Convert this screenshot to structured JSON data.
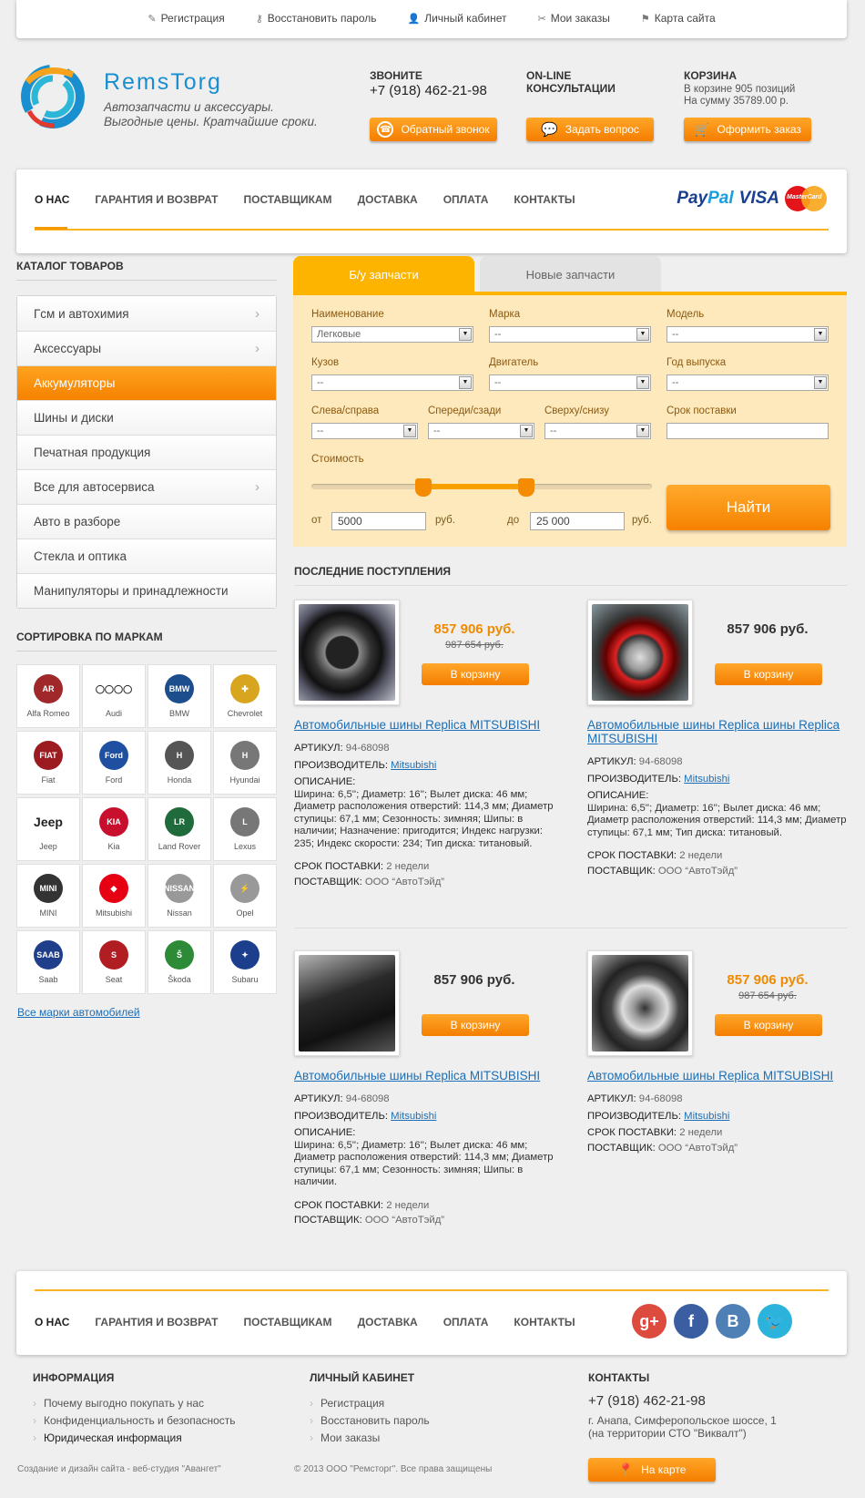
{
  "topbar": {
    "items": [
      {
        "icon": "pencil-icon",
        "glyph": "✎",
        "label": "Регистрация"
      },
      {
        "icon": "key-icon",
        "glyph": "⚷",
        "label": "Восстановить пароль"
      },
      {
        "icon": "user-icon",
        "glyph": "👤",
        "label": "Личный кабинет"
      },
      {
        "icon": "tag-icon",
        "glyph": "✂",
        "label": "Мои заказы"
      },
      {
        "icon": "flag-icon",
        "glyph": "⚑",
        "label": "Карта сайта"
      }
    ]
  },
  "header": {
    "brand": "RemsTorg",
    "slogan1": "Автозапчасти и аксессуары.",
    "slogan2": "Выгодные цены. Кратчайшие сроки.",
    "call_title": "ЗВОНИТЕ",
    "phone": "+7 (918) 462-21-98",
    "callback_btn": "Обратный звонок",
    "online_title1": "ON-LINE",
    "online_title2": "КОНСУЛЬТАЦИИ",
    "ask_btn": "Задать вопрос",
    "cart_title": "КОРЗИНА",
    "cart_line1": "В корзине 905 позиций",
    "cart_line2": "На сумму 35789.00 р.",
    "order_btn": "Оформить заказ"
  },
  "nav": {
    "items": [
      "О НАС",
      "ГАРАНТИЯ И ВОЗВРАТ",
      "ПОСТАВЩИКАМ",
      "ДОСТАВКА",
      "ОПЛАТА",
      "КОНТАКТЫ"
    ],
    "paypal1": "Pay",
    "paypal2": "Pal",
    "visa": "VISA",
    "mastercard": "MasterCard"
  },
  "sidebar": {
    "catalog_title": "КАТАЛОГ ТОВАРОВ",
    "categories": [
      {
        "label": "Гсм и автохимия",
        "arrow": true
      },
      {
        "label": "Аксессуары",
        "arrow": true
      },
      {
        "label": "Аккумуляторы",
        "arrow": false,
        "active": true
      },
      {
        "label": "Шины и диски",
        "arrow": false
      },
      {
        "label": "Печатная продукция",
        "arrow": false
      },
      {
        "label": "Все для автосервиса",
        "arrow": true
      },
      {
        "label": "Авто в разборе",
        "arrow": false
      },
      {
        "label": "Стекла и оптика",
        "arrow": false
      },
      {
        "label": "Манипуляторы и принадлежности",
        "arrow": false
      }
    ],
    "brands_title": "СОРТИРОВКА ПО МАРКАМ",
    "brands": [
      {
        "name": "Alfa Romeo",
        "color": "#a0282b",
        "mark": "AR"
      },
      {
        "name": "Audi",
        "color": "#ffffff",
        "mark": "◯◯◯◯"
      },
      {
        "name": "BMW",
        "color": "#1c4d8c",
        "mark": "BMW"
      },
      {
        "name": "Chevrolet",
        "color": "#d8a51f",
        "mark": "✚"
      },
      {
        "name": "Fiat",
        "color": "#9b1b21",
        "mark": "FIAT"
      },
      {
        "name": "Ford",
        "color": "#1f4fa0",
        "mark": "Ford"
      },
      {
        "name": "Honda",
        "color": "#555555",
        "mark": "H"
      },
      {
        "name": "Hyundai",
        "color": "#777777",
        "mark": "H"
      },
      {
        "name": "Jeep",
        "color": "#ffffff",
        "mark": "Jeep"
      },
      {
        "name": "Kia",
        "color": "#c8102e",
        "mark": "KIA"
      },
      {
        "name": "Land Rover",
        "color": "#1f6b3b",
        "mark": "LR"
      },
      {
        "name": "Lexus",
        "color": "#777777",
        "mark": "L"
      },
      {
        "name": "MINI",
        "color": "#333333",
        "mark": "MINI"
      },
      {
        "name": "Mitsubishi",
        "color": "#e60012",
        "mark": "◆"
      },
      {
        "name": "Nissan",
        "color": "#999999",
        "mark": "NISSAN"
      },
      {
        "name": "Opel",
        "color": "#999999",
        "mark": "⚡"
      },
      {
        "name": "Saab",
        "color": "#1f3f8a",
        "mark": "SAAB"
      },
      {
        "name": "Seat",
        "color": "#b01e24",
        "mark": "S"
      },
      {
        "name": "Škoda",
        "color": "#2d8a36",
        "mark": "Š"
      },
      {
        "name": "Subaru",
        "color": "#1b3f8c",
        "mark": "✦"
      }
    ],
    "all_brands": "Все марки автомобилей"
  },
  "search": {
    "tab_used": "Б/у запчасти",
    "tab_new": "Новые запчасти",
    "fields": {
      "name_label": "Наименование",
      "name_value": "Легковые",
      "brand_label": "Марка",
      "brand_value": "--",
      "model_label": "Модель",
      "model_value": "--",
      "body_label": "Кузов",
      "body_value": "--",
      "engine_label": "Двигатель",
      "engine_value": "--",
      "year_label": "Год выпуска",
      "year_value": "--",
      "lr_label": "Слева/справа",
      "lr_value": "--",
      "fb_label": "Спереди/сзади",
      "fb_value": "--",
      "tb_label": "Сверху/снизу",
      "tb_value": "--",
      "term_label": "Срок поставки",
      "term_value": ""
    },
    "price_label": "Стоимость",
    "from_label": "от",
    "from_value": "5000",
    "to_label": "до",
    "to_value": "25 000",
    "currency": "руб.",
    "slider_min_fraction": 0.33,
    "slider_max_fraction": 0.63,
    "find_btn": "Найти"
  },
  "latest": {
    "title": "ПОСЛЕДНИЕ ПОСТУПЛЕНИЯ",
    "products": [
      {
        "price": "857 906 руб.",
        "old_price": "987 654 руб.",
        "price_color": "#f08a00",
        "cart": "В корзину",
        "title": "Автомобильные шины Replica MITSUBISHI",
        "art_l": "АРТИКУЛ:",
        "art": "94-68098",
        "man_l": "ПРОИЗВОДИТЕЛЬ:",
        "man": "Mitsubishi",
        "desc_l": "ОПИСАНИЕ:",
        "desc": "Ширина: 6,5''; Диаметр: 16''; Вылет диска: 46 мм; Диаметр расположения отверстий: 114,3 мм; Диаметр ступицы: 67,1 мм; Сезонность: зимняя; Шипы: в наличии; Назначение: пригодится; Индекс нагрузки: 235; Индекс скорости: 234; Тип диска: титановый.",
        "term_l": "СРОК ПОСТАВКИ:",
        "term": "2 недели",
        "sup_l": "ПОСТАВЩИК:",
        "sup": "ООО “АвтоТэйд”"
      },
      {
        "price": "857 906 руб.",
        "old_price": "",
        "price_color": "#333333",
        "cart": "В корзину",
        "title": "Автомобильные шины Replica шины Replica MITSUBISHI",
        "art_l": "АРТИКУЛ:",
        "art": "94-68098",
        "man_l": "ПРОИЗВОДИТЕЛЬ:",
        "man": "Mitsubishi",
        "desc_l": "ОПИСАНИЕ:",
        "desc": "Ширина: 6,5''; Диаметр: 16''; Вылет диска: 46 мм; Диаметр расположения отверстий: 114,3 мм; Диаметр ступицы: 67,1 мм; Тип диска: титановый.",
        "term_l": "СРОК ПОСТАВКИ:",
        "term": "2 недели",
        "sup_l": "ПОСТАВЩИК:",
        "sup": "ООО “АвтоТэйд”"
      },
      {
        "price": "857 906 руб.",
        "old_price": "",
        "price_color": "#333333",
        "cart": "В корзину",
        "title": "Автомобильные шины Replica MITSUBISHI",
        "art_l": "АРТИКУЛ:",
        "art": "94-68098",
        "man_l": "ПРОИЗВОДИТЕЛЬ:",
        "man": "Mitsubishi",
        "desc_l": "ОПИСАНИЕ:",
        "desc": "Ширина: 6,5''; Диаметр: 16''; Вылет диска: 46 мм; Диаметр расположения отверстий: 114,3 мм; Диаметр ступицы: 67,1 мм; Сезонность: зимняя; Шипы: в наличии.",
        "term_l": "СРОК ПОСТАВКИ:",
        "term": "2 недели",
        "sup_l": "ПОСТАВЩИК:",
        "sup": "ООО “АвтоТэйд”"
      },
      {
        "price": "857 906 руб.",
        "old_price": "987 654 руб.",
        "price_color": "#f08a00",
        "cart": "В корзину",
        "title": "Автомобильные шины Replica MITSUBISHI",
        "art_l": "АРТИКУЛ:",
        "art": "94-68098",
        "man_l": "ПРОИЗВОДИТЕЛЬ:",
        "man": "Mitsubishi",
        "desc_l": "",
        "desc": "",
        "term_l": "СРОК ПОСТАВКИ:",
        "term": "2 недели",
        "sup_l": "ПОСТАВЩИК:",
        "sup": "ООО “АвтоТэйд”"
      }
    ]
  },
  "footer": {
    "nav": [
      "О НАС",
      "ГАРАНТИЯ И ВОЗВРАТ",
      "ПОСТАВЩИКАМ",
      "ДОСТАВКА",
      "ОПЛАТА",
      "КОНТАКТЫ"
    ],
    "social": [
      {
        "icon": "google-plus-icon",
        "glyph": "g+",
        "color": "#dc4b3e"
      },
      {
        "icon": "facebook-icon",
        "glyph": "f",
        "color": "#3b5ea3"
      },
      {
        "icon": "vk-icon",
        "glyph": "B",
        "color": "#4e7fb5"
      },
      {
        "icon": "twitter-icon",
        "glyph": "🐦",
        "color": "#2bb3dc"
      }
    ],
    "info_title": "ИНФОРМАЦИЯ",
    "info_items": [
      "Почему выгодно покупать у нас",
      "Конфиденциальность и безопасность",
      "Юридическая информация"
    ],
    "account_title": "ЛИЧНЫЙ КАБИНЕТ",
    "account_items": [
      "Регистрация",
      "Восстановить пароль",
      "Мои заказы"
    ],
    "contacts_title": "КОНТАКТЫ",
    "phone": "+7 (918) 462-21-98",
    "address1": "г. Анапа, Симферопольское шоссе, 1",
    "address2": "(на территории СТО \"Виквалт\")",
    "map_btn": "На карте",
    "credit": "Создание и дизайн сайта - веб-студия \"Авангет\"",
    "copyright": "© 2013 ООО \"Ремсторг\". Все права защищены"
  }
}
